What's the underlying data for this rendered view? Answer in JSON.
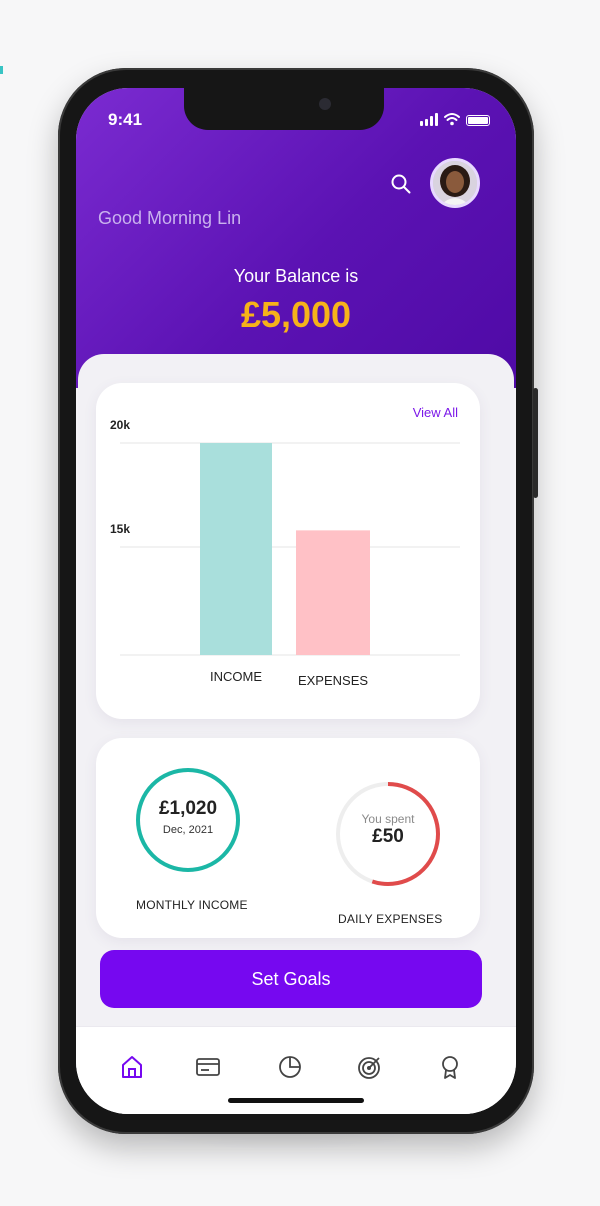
{
  "status_bar": {
    "time": "9:41"
  },
  "header": {
    "greeting": "Good Morning Lin",
    "balance_label": "Your Balance is",
    "balance_value": "£5,000"
  },
  "chart_card": {
    "view_all_label": "View All",
    "chart_data": {
      "type": "bar",
      "categories": [
        "INCOME",
        "EXPENSES"
      ],
      "values": [
        20000,
        15800
      ],
      "colors": [
        "#a9dfdc",
        "#ffc1c6"
      ],
      "yticks": [
        "20k",
        "15k"
      ],
      "title": "",
      "xlabel": "",
      "ylabel": ""
    }
  },
  "stats": {
    "monthly_income": {
      "amount": "£1,020",
      "period": "Dec, 2021",
      "caption": "MONTHLY INCOME",
      "ring_color": "#1bb7a6",
      "fill": 1.0
    },
    "daily_expenses": {
      "prefix": "You spent",
      "amount": "£50",
      "caption": "DAILY EXPENSES",
      "ring_color": "#e04b4b",
      "fill": 0.55
    }
  },
  "actions": {
    "set_goals_label": "Set Goals"
  },
  "nav": {
    "items": [
      {
        "icon": "home-icon",
        "active": true
      },
      {
        "icon": "card-icon",
        "active": false
      },
      {
        "icon": "pie-chart-icon",
        "active": false
      },
      {
        "icon": "target-icon",
        "active": false
      },
      {
        "icon": "award-icon",
        "active": false
      }
    ],
    "accent_color": "#7608f0"
  }
}
